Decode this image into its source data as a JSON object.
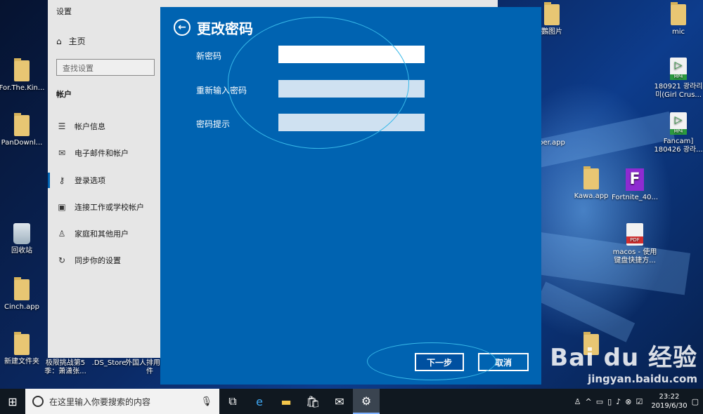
{
  "desktop": {
    "icons_left": [
      {
        "label": "For.The.Kin...",
        "kind": "folder"
      },
      {
        "label": "PanDownl...",
        "kind": "folder"
      },
      {
        "label": "回收站",
        "kind": "bin"
      },
      {
        "label": "Cinch.app",
        "kind": "folder"
      },
      {
        "label": "新建文件夹",
        "kind": "folder"
      }
    ],
    "icons_bottom": [
      {
        "label": "极限挑战第5季：萧潇张..."
      },
      {
        "label": ".DS_Store"
      },
      {
        "label": "外国人排用的软件"
      }
    ],
    "icons_right": [
      {
        "label": "鸚图片"
      },
      {
        "label": "mic"
      },
      {
        "label": "180921 광라리 미(Girl Crus..."
      },
      {
        "label": "Fancam] 180426 광라..."
      },
      {
        "label": "per.app"
      },
      {
        "label": "Kawa.app"
      },
      {
        "label": "Fortnite_40..."
      },
      {
        "label": "macos - 使用键盘快捷方..."
      }
    ]
  },
  "settings": {
    "title": "设置",
    "home_label": "主页",
    "search_placeholder": "查找设置",
    "section": "帐户",
    "nav": [
      {
        "label": "帐户信息",
        "icon": "account-info-icon",
        "glyph": "☰"
      },
      {
        "label": "电子邮件和帐户",
        "icon": "mail-icon",
        "glyph": "✉"
      },
      {
        "label": "登录选项",
        "icon": "key-icon",
        "glyph": "⚷"
      },
      {
        "label": "连接工作或学校帐户",
        "icon": "briefcase-icon",
        "glyph": "▣"
      },
      {
        "label": "家庭和其他用户",
        "icon": "family-icon",
        "glyph": "♙"
      },
      {
        "label": "同步你的设置",
        "icon": "sync-icon",
        "glyph": "↻"
      }
    ],
    "selected": "登录选项"
  },
  "dialog": {
    "title": "更改密码",
    "fields": [
      {
        "label": "新密码",
        "value": ""
      },
      {
        "label": "重新输入密码",
        "value": ""
      },
      {
        "label": "密码提示",
        "value": ""
      }
    ],
    "next_label": "下一步",
    "cancel_label": "取消"
  },
  "taskbar": {
    "search_placeholder": "在这里输入你要搜索的内容",
    "time": "23:22",
    "date": "2019/6/30"
  },
  "watermark": {
    "logo": "Bai du 经验",
    "url": "jingyan.baidu.com"
  },
  "colors": {
    "dialog_bg": "#0063b1",
    "annotation": "#37b8e8",
    "taskbar": "#101820"
  }
}
